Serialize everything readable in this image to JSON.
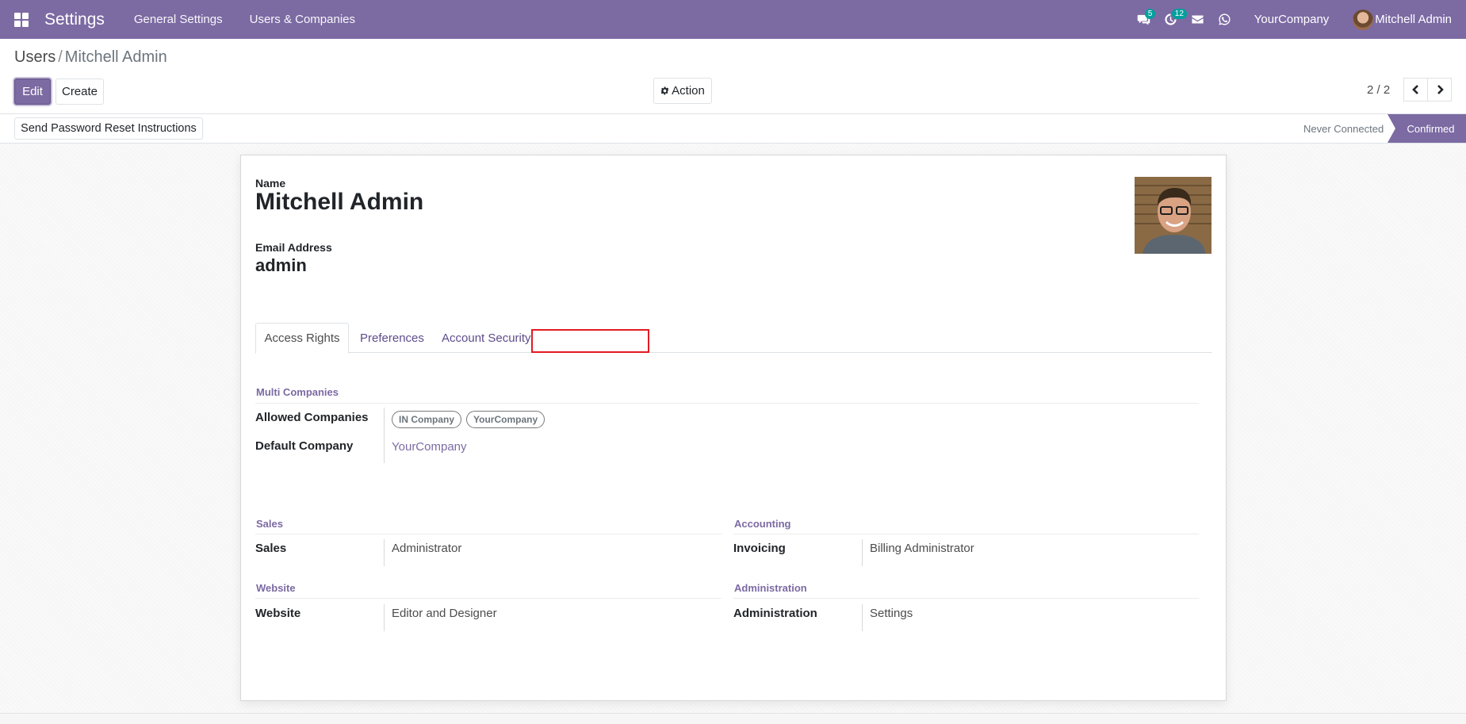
{
  "navbar": {
    "app_title": "Settings",
    "menu": [
      "General Settings",
      "Users & Companies"
    ],
    "messages_count": "5",
    "activities_count": "12",
    "company": "YourCompany",
    "user": "Mitchell Admin",
    "icons": [
      "apps-icon",
      "chat-icon",
      "clock-icon",
      "envelope-icon",
      "whatsapp-icon"
    ]
  },
  "breadcrumb": {
    "parent": "Users",
    "separator": "/",
    "current": "Mitchell Admin"
  },
  "toolbar": {
    "edit": "Edit",
    "create": "Create",
    "action": "Action"
  },
  "pager": {
    "value": "2 / 2"
  },
  "statusbar": {
    "reset_button": "Send Password Reset Instructions",
    "state_never": "Never Connected",
    "state_confirmed": "Confirmed"
  },
  "form": {
    "name_label": "Name",
    "name": "Mitchell Admin",
    "email_label": "Email Address",
    "email": "admin"
  },
  "tabs": [
    "Access Rights",
    "Preferences",
    "Account Security"
  ],
  "multi_companies": {
    "title": "Multi Companies",
    "allowed_label": "Allowed Companies",
    "allowed": [
      "IN Company",
      "YourCompany"
    ],
    "default_label": "Default Company",
    "default": "YourCompany"
  },
  "groups": {
    "sales": {
      "title": "Sales",
      "label": "Sales",
      "value": "Administrator"
    },
    "accounting": {
      "title": "Accounting",
      "label": "Invoicing",
      "value": "Billing Administrator"
    },
    "website": {
      "title": "Website",
      "label": "Website",
      "value": "Editor and Designer"
    },
    "administration": {
      "title": "Administration",
      "label": "Administration",
      "value": "Settings"
    }
  },
  "colors": {
    "brand": "#7c6aa3",
    "badge": "#00a09d",
    "highlight": "#e31b23"
  }
}
